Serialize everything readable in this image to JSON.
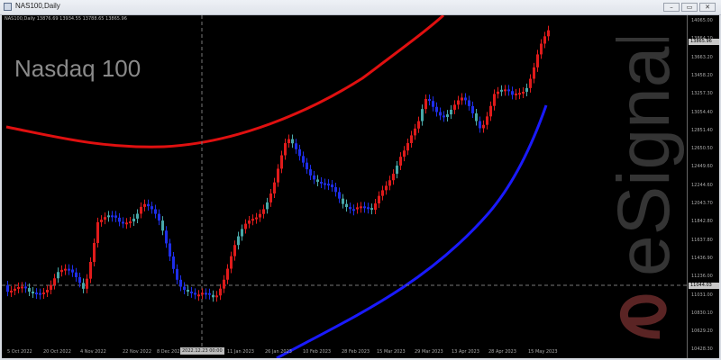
{
  "window": {
    "title": "NAS100,Daily",
    "buttons": [
      "–",
      "▭",
      "✕"
    ]
  },
  "chart_info": "NAS100,Daily  13876.69 13934.55 13788.65 13865.96",
  "overlay_title": "Nasdaq 100",
  "watermark": "eSignal",
  "y_axis": {
    "ticks": [
      "14065.00",
      "13864.10",
      "13663.20",
      "13458.20",
      "13257.30",
      "13054.40",
      "12851.40",
      "12650.50",
      "12449.60",
      "12244.60",
      "12043.70",
      "11842.80",
      "11637.80",
      "11436.90",
      "11236.00",
      "11031.00",
      "10830.10",
      "10629.20",
      "10428.30"
    ],
    "current_price": "13865.96",
    "crosshair_price": "11044.03"
  },
  "x_axis": {
    "ticks": [
      "5 Oct 2022",
      "20 Oct 2022",
      "4 Nov 2022",
      "22 Nov 2022",
      "8 Dec 2022",
      "11 Jan 2023",
      "26 Jan 2023",
      "10 Feb 2023",
      "28 Feb 2023",
      "15 Mar 2023",
      "29 Mar 2023",
      "13 Apr 2023",
      "28 Apr 2023",
      "15 May 2023"
    ],
    "crosshair_date": "2022.12.23 00:00"
  },
  "colors": {
    "up": "#e01b1b",
    "down": "#1e2ee8",
    "neutral": "#48a8a8",
    "upper_band": "#e01010",
    "lower_band": "#1a1aff"
  }
}
